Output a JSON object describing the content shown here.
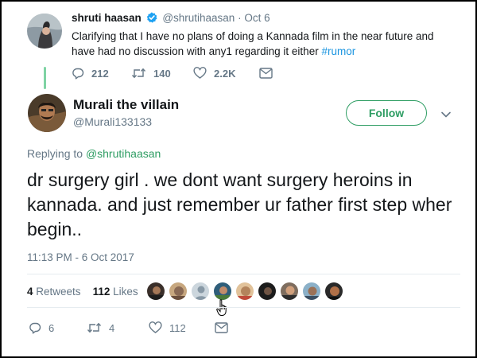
{
  "quoted_tweet": {
    "name": "shruti haasan",
    "handle": "@shrutihaasan",
    "separator": "·",
    "date": "Oct 6",
    "text": "Clarifying that I have no plans of doing a Kannada film in the near future and have had no discussion with any1 regarding it either ",
    "hashtag": "#rumor",
    "replies": "212",
    "retweets": "140",
    "likes": "2.2K"
  },
  "main_tweet": {
    "name": "Murali the villain",
    "handle": "@Murali133133",
    "follow_label": "Follow",
    "replying_prefix": "Replying to ",
    "replying_handle": "@shrutihaasan",
    "text": "dr surgery girl . we dont want surgery heroins in kannada. and just remember ur father first step wher begin..",
    "timestamp": "11:13 PM - 6 Oct 2017",
    "retweet_count": "4",
    "retweet_label": "Retweets",
    "like_count": "112",
    "like_label": "Likes",
    "actions": {
      "replies": "6",
      "retweets": "4",
      "likes": "112"
    }
  },
  "colors": {
    "accent_green": "#2e9d63",
    "hashtag_blue": "#1b95e0",
    "muted_text": "#657786",
    "verified_blue": "#1da1f2"
  },
  "icons": [
    "verified-badge-icon",
    "reply-icon",
    "retweet-icon",
    "heart-icon",
    "direct-message-icon",
    "chevron-down-icon",
    "hand-cursor-icon"
  ]
}
